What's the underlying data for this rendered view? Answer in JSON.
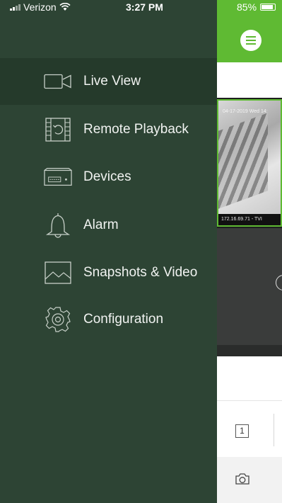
{
  "status_bar": {
    "carrier": "Verizon",
    "time": "3:27 PM",
    "battery": "85%"
  },
  "drawer": {
    "active_item": "Live View",
    "items": [
      {
        "label": "Live View",
        "icon": "video-camera-icon"
      },
      {
        "label": "Remote Playback",
        "icon": "film-playback-icon"
      },
      {
        "label": "Devices",
        "icon": "nvr-device-icon"
      },
      {
        "label": "Alarm",
        "icon": "bell-icon"
      },
      {
        "label": "Snapshots & Video",
        "icon": "image-icon"
      },
      {
        "label": "Configuration",
        "icon": "gear-icon"
      }
    ]
  },
  "background_app": {
    "camera_tile": {
      "timestamp": "04-17-2019 Wed 14:",
      "label": "172.16.69.71 - TVI"
    },
    "split_button_label": "1"
  },
  "colors": {
    "drawer_bg": "#2d4434",
    "drawer_active_bg": "#253a2b",
    "header_green": "#5fba33"
  }
}
